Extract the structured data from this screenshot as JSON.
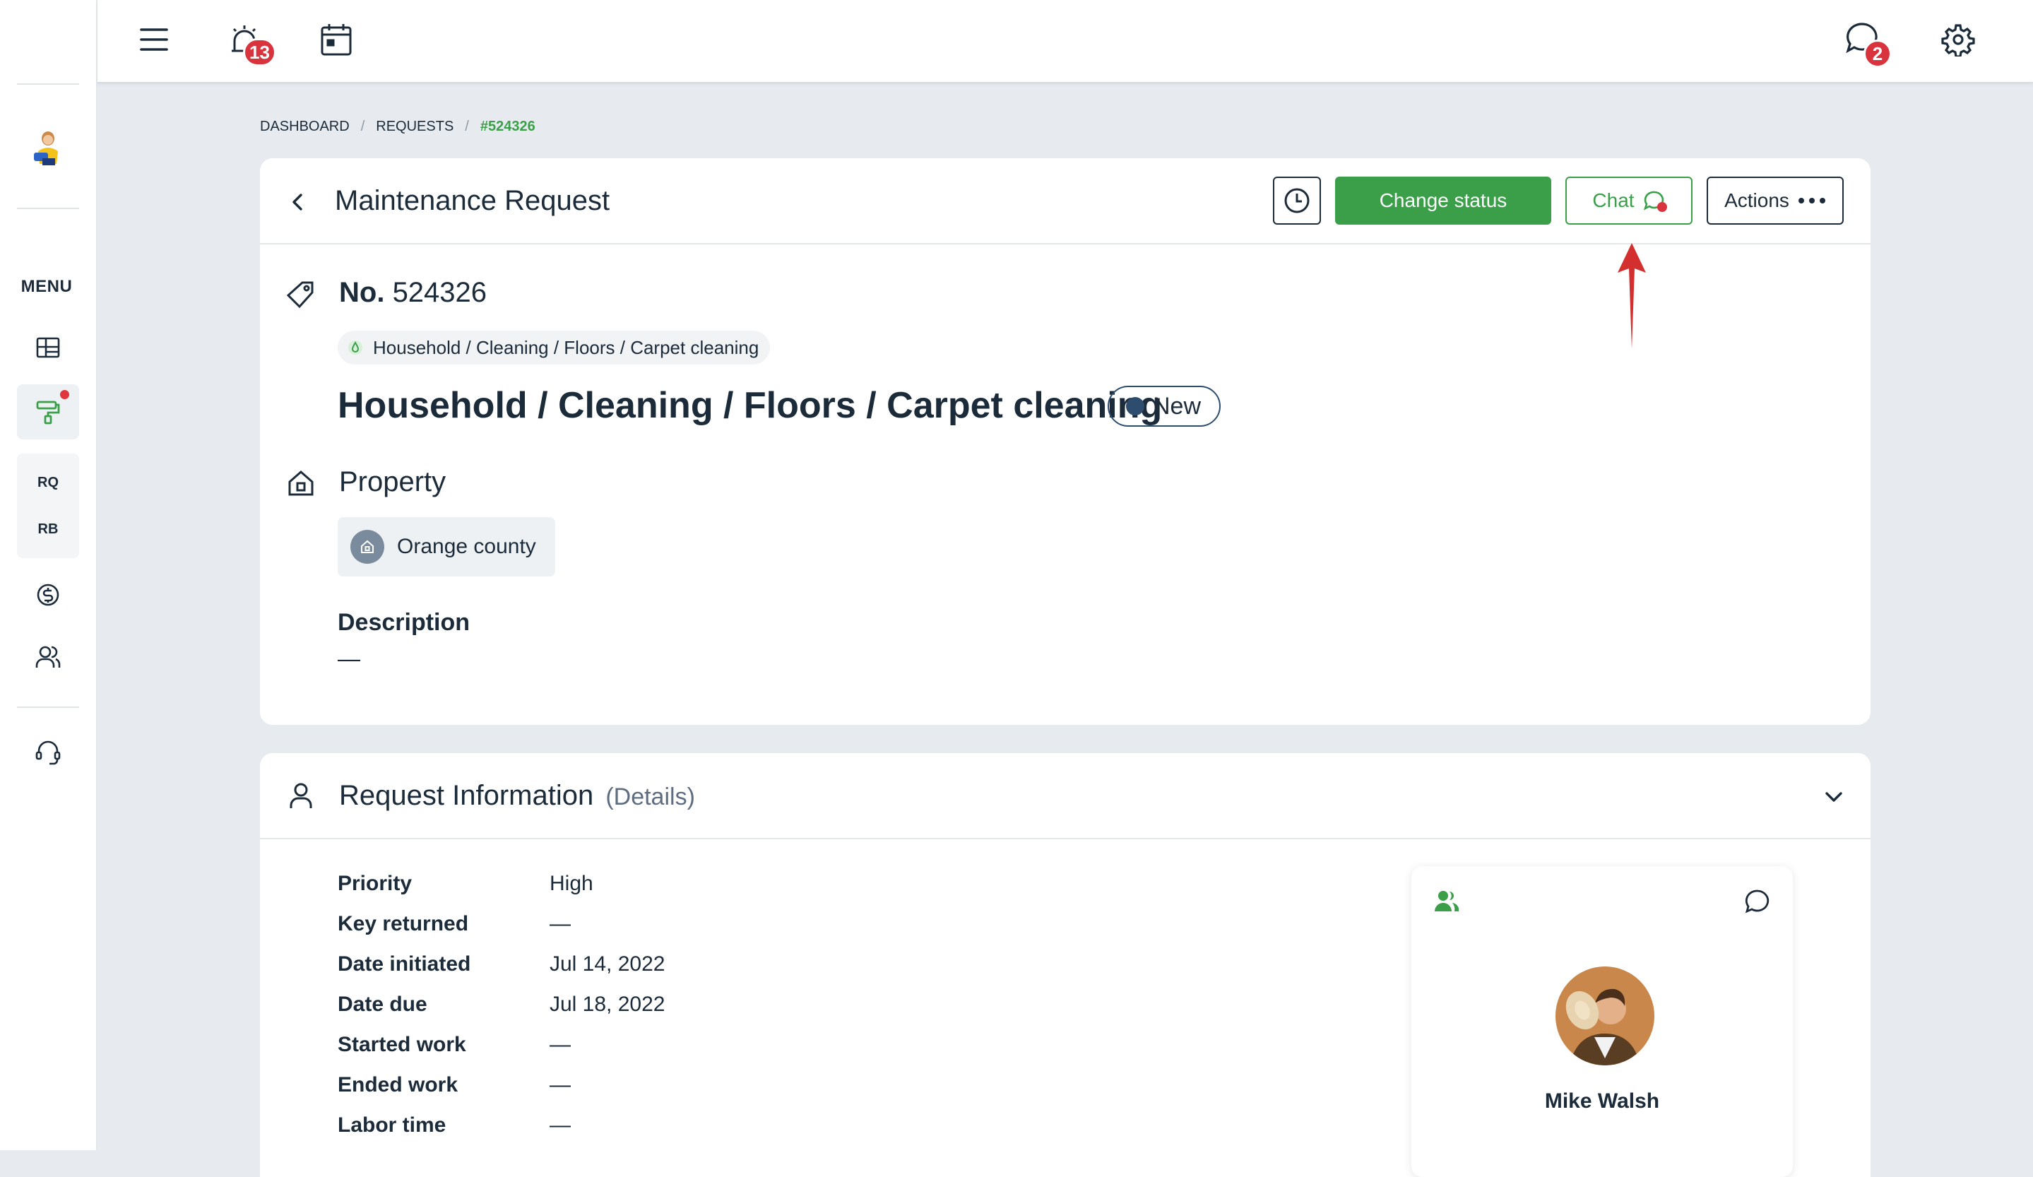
{
  "sidebar": {
    "menu_label": "MENU",
    "sub_items": [
      "RQ",
      "RB"
    ]
  },
  "topbar": {
    "alarm_badge": "13",
    "chat_badge": "2"
  },
  "breadcrumb": {
    "items": [
      "DASHBOARD",
      "REQUESTS",
      "#524326"
    ]
  },
  "request": {
    "page_title": "Maintenance Request",
    "buttons": {
      "change_status": "Change status",
      "chat": "Chat",
      "actions": "Actions"
    },
    "number_label": "No.",
    "number_value": "524326",
    "category_chip": "Household / Cleaning / Floors / Carpet cleaning",
    "category_title": "Household / Cleaning / Floors / Carpet cleaning",
    "status": "New",
    "property_title": "Property",
    "property_name": "Orange county",
    "description_label": "Description",
    "description_value": "—"
  },
  "request_info": {
    "title": "Request Information",
    "subtitle": "(Details)",
    "rows": [
      {
        "label": "Priority",
        "value": "High"
      },
      {
        "label": "Key returned",
        "value": "—"
      },
      {
        "label": "Date initiated",
        "value": "Jul 14, 2022"
      },
      {
        "label": "Date due",
        "value": "Jul 18, 2022"
      },
      {
        "label": "Started work",
        "value": "—"
      },
      {
        "label": "Ended work",
        "value": "—"
      },
      {
        "label": "Labor time",
        "value": "—"
      }
    ],
    "assignee_name": "Mike Walsh"
  },
  "colors": {
    "accent_green": "#3a9f48",
    "badge_red": "#d9343d",
    "status_navy": "#2d4c6e",
    "annotation_arrow": "#d32f2f"
  }
}
